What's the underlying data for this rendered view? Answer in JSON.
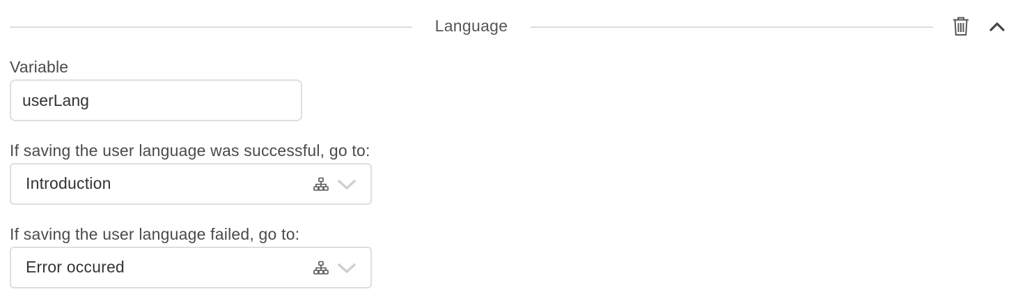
{
  "section": {
    "title": "Language",
    "icons": {
      "delete": "trash-icon",
      "collapse": "chevron-up-icon"
    }
  },
  "variable": {
    "label": "Variable",
    "value": "userLang"
  },
  "success": {
    "label": "If saving the user language was successful, go to:",
    "selected": "Introduction"
  },
  "failure": {
    "label": "If saving the user language failed, go to:",
    "selected": "Error occured"
  },
  "colors": {
    "border": "#dedede",
    "text": "#4a4a4a",
    "icon": "#555555",
    "chevron_muted": "#cfcfcf"
  }
}
